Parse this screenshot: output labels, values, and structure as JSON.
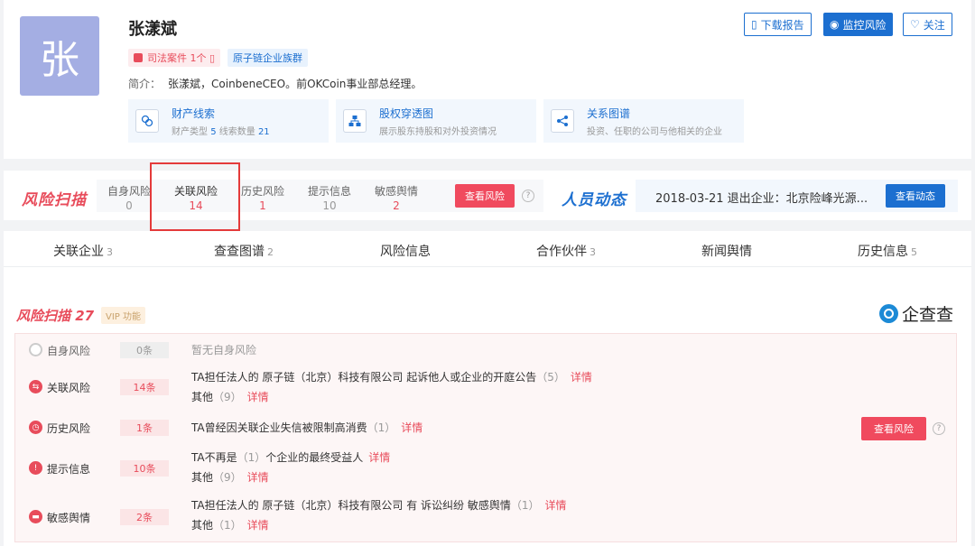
{
  "profile": {
    "avatar_char": "张",
    "name": "张漾斌",
    "tags": {
      "judicial": "司法案件 1个 ▯",
      "group": "原子链企业族群"
    },
    "intro_key": "简介：",
    "intro_value": "张漾斌，CoinbeneCEO。前OKCoin事业部总经理。",
    "features": [
      {
        "title": "财产线索",
        "sub_a": "财产类型",
        "sub_a_val": "5",
        "sub_b": "线索数量",
        "sub_b_val": "21",
        "icon": "money-icon"
      },
      {
        "title": "股权穿透图",
        "sub": "展示股东持股和对外投资情况",
        "icon": "org-chart-icon"
      },
      {
        "title": "关系图谱",
        "sub": "投资、任职的公司与他相关的企业",
        "icon": "share-icon"
      }
    ],
    "buttons": {
      "download": "下载报告",
      "monitor": "监控风险",
      "follow": "关注"
    }
  },
  "scan": {
    "logo": "风险扫描",
    "items": [
      {
        "label": "自身风险",
        "value": "0"
      },
      {
        "label": "关联风险",
        "value": "14"
      },
      {
        "label": "历史风险",
        "value": "1"
      },
      {
        "label": "提示信息",
        "value": "10"
      },
      {
        "label": "敏感舆情",
        "value": "2"
      }
    ],
    "view_btn": "查看风险",
    "help": "?",
    "dynamics_logo": "人员动态",
    "dynamics_text": "2018-03-21 退出企业：北京险峰光源...",
    "dynamics_btn": "查看动态"
  },
  "tabs": [
    {
      "label": "关联企业",
      "count": "3"
    },
    {
      "label": "查查图谱",
      "count": "2"
    },
    {
      "label": "风险信息",
      "count": ""
    },
    {
      "label": "合作伙伴",
      "count": "3"
    },
    {
      "label": "新闻舆情",
      "count": ""
    },
    {
      "label": "历史信息",
      "count": "5"
    }
  ],
  "main": {
    "title": "风险扫描 27",
    "vip": "VIP 功能",
    "brand": "企查查",
    "view_btn": "查看风险",
    "help": "?",
    "rows": [
      {
        "label": "自身风险",
        "count": "0条",
        "line1": "暂无自身风险"
      },
      {
        "label": "关联风险",
        "count": "14条",
        "line1": "TA担任法人的 原子链（北京）科技有限公司 起诉他人或企业的开庭公告",
        "line1_cnt": "（5）",
        "line1_link": "详情",
        "line2": "其他",
        "line2_cnt": "（9）",
        "line2_link": "详情"
      },
      {
        "label": "历史风险",
        "count": "1条",
        "line1": "TA曾经因关联企业失信被限制高消费",
        "line1_cnt": "（1）",
        "line1_link": "详情"
      },
      {
        "label": "提示信息",
        "count": "10条",
        "line1": "TA不再是",
        "line1_cnt": "（1）",
        "line1_b": "个企业的最终受益人",
        "line1_link": "详情",
        "line2": "其他",
        "line2_cnt": "（9）",
        "line2_link": "详情"
      },
      {
        "label": "敏感舆情",
        "count": "2条",
        "line1": "TA担任法人的 原子链（北京）科技有限公司 有 诉讼纠纷 敏感舆情",
        "line1_cnt": "（1）",
        "line1_link": "详情",
        "line2": "其他",
        "line2_cnt": "（1）",
        "line2_link": "详情"
      }
    ]
  },
  "colors": {
    "accent_red": "#e84c5b",
    "accent_blue": "#1c6fd0",
    "avatar_bg": "#a4aee3"
  }
}
